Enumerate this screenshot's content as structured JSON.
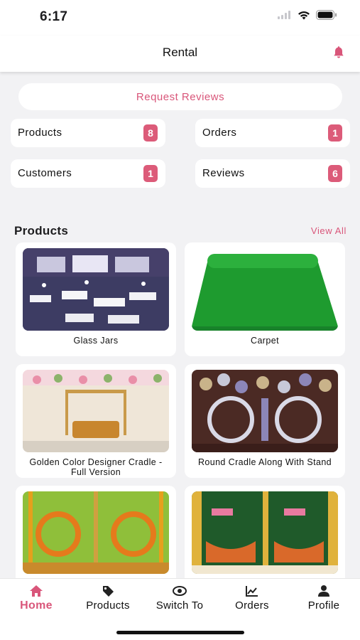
{
  "status_bar": {
    "time": "6:17"
  },
  "header": {
    "title": "Rental",
    "bell_icon": "bell-icon"
  },
  "request_reviews": {
    "label": "Request Reviews"
  },
  "stats": [
    {
      "label": "Products",
      "count": "8"
    },
    {
      "label": "Orders",
      "count": "1"
    },
    {
      "label": "Customers",
      "count": "1"
    },
    {
      "label": "Reviews",
      "count": "6"
    }
  ],
  "products_section": {
    "title": "Products",
    "view_all": "View All",
    "items": [
      {
        "name": "Glass Jars"
      },
      {
        "name": "Carpet"
      },
      {
        "name": "Golden Color Designer Cradle - Full Version"
      },
      {
        "name": "Round Cradle Along With Stand"
      },
      {
        "name": ""
      },
      {
        "name": ""
      }
    ]
  },
  "tabbar": {
    "tabs": [
      {
        "label": "Home",
        "icon": "home-icon",
        "active": true
      },
      {
        "label": "Products",
        "icon": "tag-icon"
      },
      {
        "label": "Switch To",
        "icon": "switch-icon"
      },
      {
        "label": "Orders",
        "icon": "chart-icon"
      },
      {
        "label": "Profile",
        "icon": "user-icon"
      }
    ]
  },
  "colors": {
    "accent": "#d9567a",
    "badge": "#dc5b79",
    "background": "#f2f2f4"
  }
}
